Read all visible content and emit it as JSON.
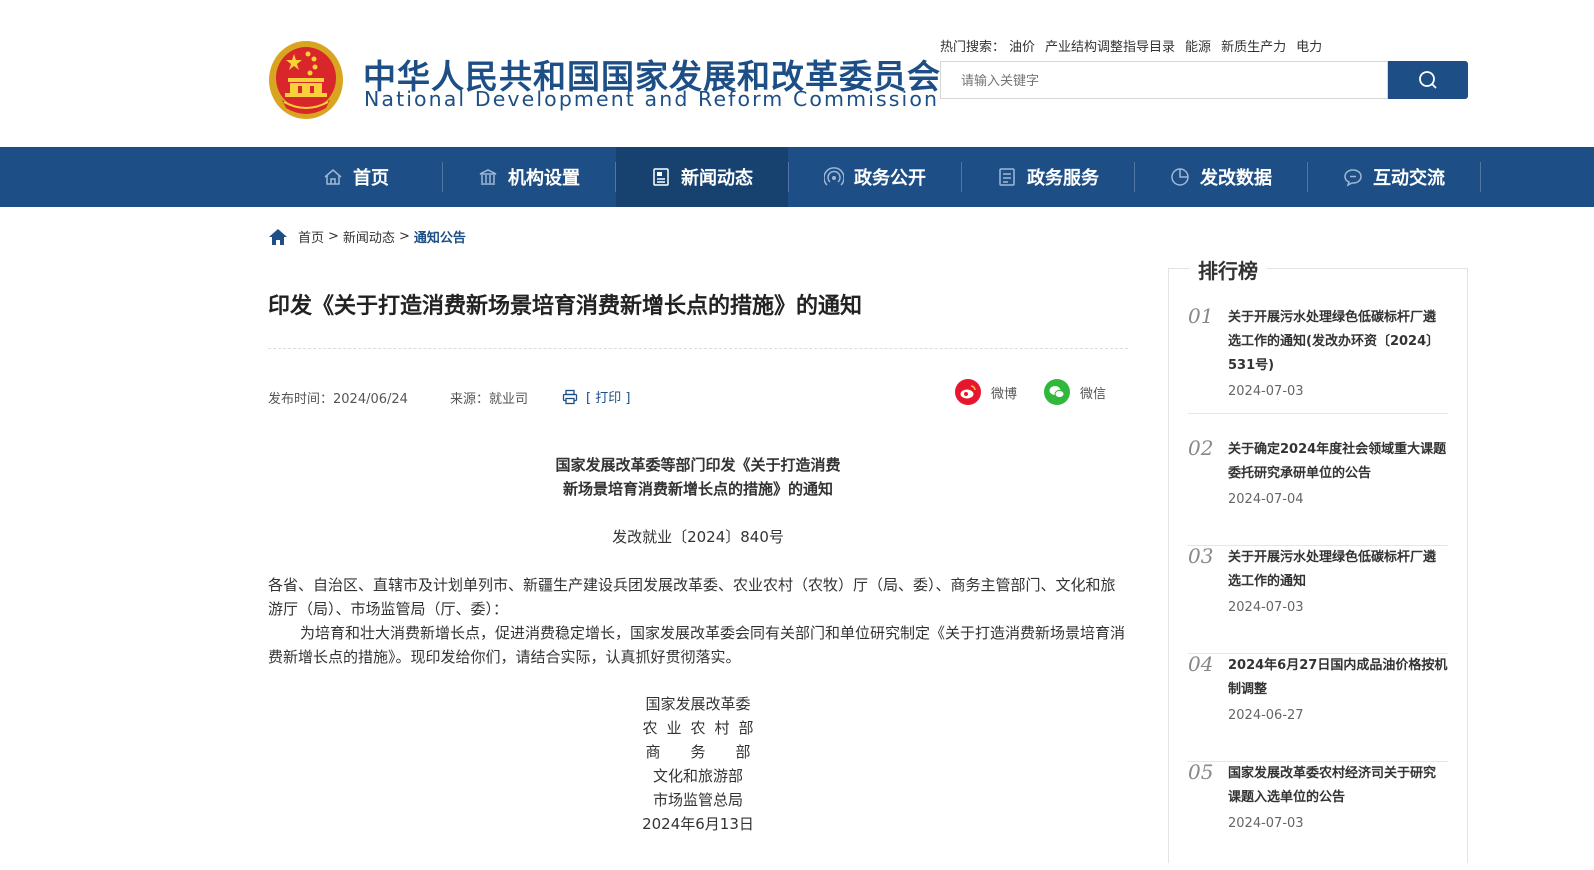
{
  "header": {
    "title_cn": "中华人民共和国国家发展和改革委员会",
    "title_en": "National Development and Reform Commission",
    "hot_label": "热门搜索：",
    "hot_terms": [
      "油价",
      "产业结构调整指导目录",
      "能源",
      "新质生产力",
      "电力"
    ],
    "search_placeholder": "请输入关键字"
  },
  "nav": {
    "items": [
      {
        "label": "首页",
        "icon": "home-icon"
      },
      {
        "label": "机构设置",
        "icon": "building-icon"
      },
      {
        "label": "新闻动态",
        "icon": "news-icon"
      },
      {
        "label": "政务公开",
        "icon": "broadcast-icon"
      },
      {
        "label": "政务服务",
        "icon": "document-icon"
      },
      {
        "label": "发改数据",
        "icon": "pie-chart-icon"
      },
      {
        "label": "互动交流",
        "icon": "chat-icon"
      }
    ],
    "active_index": 2
  },
  "breadcrumb": {
    "items": [
      "首页",
      "新闻动态",
      "通知公告"
    ],
    "separator": ">"
  },
  "article": {
    "title": "印发《关于打造消费新场景培育消费新增长点的措施》的通知",
    "date": "发布时间：2024/06/24",
    "source": "来源：就业司",
    "print_label": "[ 打印 ]",
    "share": [
      {
        "label": "微博",
        "icon": "weibo-icon",
        "color": "#e6162d"
      },
      {
        "label": "微信",
        "icon": "wechat-icon",
        "color": "#2fb83a"
      }
    ],
    "doc_title_line1": "国家发展改革委等部门印发《关于打造消费",
    "doc_title_line2": "新场景培育消费新增长点的措施》的通知",
    "doc_number": "发改就业〔2024〕840号",
    "recipients": "各省、自治区、直辖市及计划单列市、新疆生产建设兵团发展改革委、农业农村（农牧）厅（局、委）、商务主管部门、文化和旅游厅（局）、市场监管局（厅、委）：",
    "body": "为培育和壮大消费新增长点，促进消费稳定增长，国家发展改革委会同有关部门和单位研究制定《关于打造消费新场景培育消费新增长点的措施》。现印发给你们，请结合实际，认真抓好贯彻落实。",
    "signers": [
      "国家发展改革委",
      "农业农村部",
      "商务部",
      "文化和旅游部",
      "市场监管总局"
    ],
    "sign_date": "2024年6月13日"
  },
  "ranking": {
    "title": "排行榜",
    "items": [
      {
        "num": "01",
        "title": "关于开展污水处理绿色低碳标杆厂遴选工作的通知(发改办环资〔2024〕531号)",
        "date": "2024-07-03"
      },
      {
        "num": "02",
        "title": "关于确定2024年度社会领域重大课题委托研究承研单位的公告",
        "date": "2024-07-04"
      },
      {
        "num": "03",
        "title": "关于开展污水处理绿色低碳标杆厂遴选工作的通知",
        "date": "2024-07-03"
      },
      {
        "num": "04",
        "title": "2024年6月27日国内成品油价格按机制调整",
        "date": "2024-06-27"
      },
      {
        "num": "05",
        "title": "国家发展改革委农村经济司关于研究课题入选单位的公告",
        "date": "2024-07-03"
      }
    ]
  },
  "colors": {
    "brand": "#1d4f86",
    "nav_active": "#17426f"
  }
}
